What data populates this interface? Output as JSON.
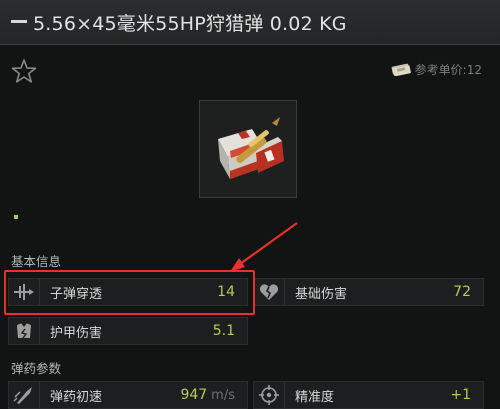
{
  "header": {
    "title": "5.56×45毫米55HP狩猎弹 0.02 KG"
  },
  "price": {
    "label": "参考单价:12",
    "icon": "cash-icon"
  },
  "item": {
    "icon": "ammo-box-icon"
  },
  "sections": {
    "basic_info": "基本信息",
    "ammo_params": "弹药参数"
  },
  "stats": {
    "penetration": {
      "label": "子弹穿透",
      "value": "14",
      "icon": "penetration-icon"
    },
    "damage": {
      "label": "基础伤害",
      "value": "72",
      "icon": "broken-heart-icon"
    },
    "armor_damage": {
      "label": "护甲伤害",
      "value": "5.1",
      "icon": "armor-damage-icon"
    },
    "velocity": {
      "label": "弹药初速",
      "value": "947",
      "unit": "m/s",
      "icon": "bullet-speed-icon"
    },
    "accuracy": {
      "label": "精准度",
      "value": "+1",
      "icon": "crosshair-icon"
    }
  },
  "colors": {
    "highlight": "#e8302c",
    "value": "#b2cf5c",
    "background": "#121313"
  }
}
